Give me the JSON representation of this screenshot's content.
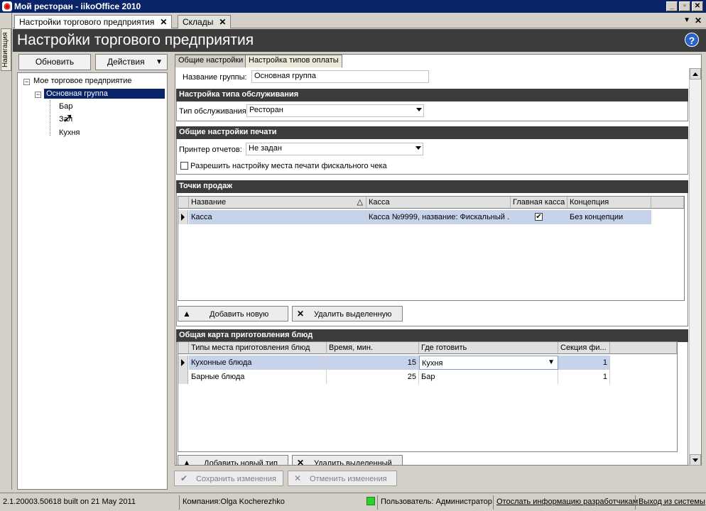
{
  "window": {
    "title": "Мой ресторан - iikoOffice 2010"
  },
  "doc_tabs": [
    {
      "label": "Настройки торгового предприятия"
    },
    {
      "label": "Склады"
    }
  ],
  "nav_strip": {
    "label": "Навигация"
  },
  "page": {
    "title": "Настройки торгового предприятия"
  },
  "left_panel": {
    "refresh_label": "Обновить",
    "actions_label": "Действия",
    "tree": {
      "root": "Мое торговое предприятие",
      "group": "Основная группа",
      "children": [
        "Бар",
        "Зал",
        "Кухня"
      ]
    }
  },
  "panel_tabs": [
    {
      "label": "Общие настройки"
    },
    {
      "label": "Настройка типов оплаты"
    }
  ],
  "group_name": {
    "label": "Название группы:",
    "value": "Основная группа"
  },
  "service": {
    "section_title": "Настройка типа обслуживания",
    "label": "Тип обслуживания:",
    "value": "Ресторан"
  },
  "print": {
    "section_title": "Общие настройки печати",
    "printer_label": "Принтер отчетов:",
    "printer_value": "Не задан",
    "fiscal_checkbox_label": "Разрешить настройку места печати фискального чека",
    "fiscal_checked": false
  },
  "sales_points": {
    "section_title": "Точки продаж",
    "columns": [
      "Название",
      "Касса",
      "Главная касса",
      "Концепция"
    ],
    "rows": [
      {
        "name": "Касса",
        "cashbox": "Касса №9999, название: Фискальный ...",
        "main": true,
        "concept": "Без концепции"
      }
    ],
    "add_label": "Добавить новую",
    "delete_label": "Удалить выделенную"
  },
  "cooking": {
    "section_title": "Общая карта приготовления блюд",
    "columns": [
      "Типы места приготовления блюд",
      "Время, мин.",
      "Где готовить",
      "Секция фи..."
    ],
    "rows": [
      {
        "type": "Кухонные блюда",
        "time": "15",
        "where": "Кухня",
        "section": "1"
      },
      {
        "type": "Барные блюда",
        "time": "25",
        "where": "Бар",
        "section": "1"
      }
    ],
    "add_label": "Добавить новый тип",
    "delete_label": "Удалить выделенный"
  },
  "bottom": {
    "save_label": "Сохранить изменения",
    "cancel_label": "Отменить изменения"
  },
  "status": {
    "build": "2.1.20003.50618 built on 21 May 2011",
    "company": "Компания:Olga Kocherezhko",
    "user": "Пользователь: Администратор",
    "send_info": "Отослать информацию разработчикам",
    "exit": "Выход из системы"
  },
  "colors": {
    "titlebar": "#0a246a",
    "section_header": "#3c3c3c",
    "selection": "#c6d3ea",
    "status_led": "#2fcf2f"
  }
}
